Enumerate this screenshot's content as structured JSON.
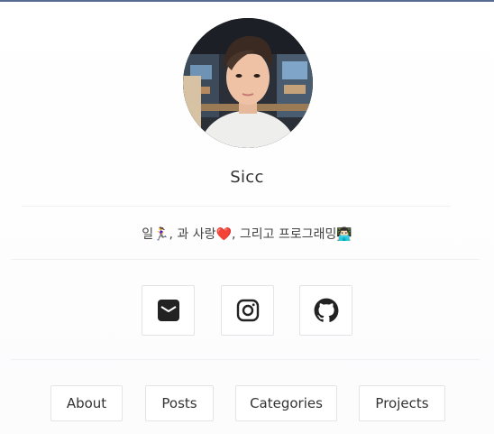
{
  "profile": {
    "name": "Sicc",
    "bio": "일🏃‍♀️, 과 사랑❤️, 그리고 프로그래밍👨🏻‍💻"
  },
  "social": [
    {
      "icon": "email-icon"
    },
    {
      "icon": "instagram-icon"
    },
    {
      "icon": "github-icon"
    }
  ],
  "nav": {
    "about": "About",
    "posts": "Posts",
    "categories": "Categories",
    "projects": "Projects"
  },
  "colors": {
    "accent_top": "#5a6b91",
    "border": "#e2e4e8",
    "icon": "#222222"
  }
}
